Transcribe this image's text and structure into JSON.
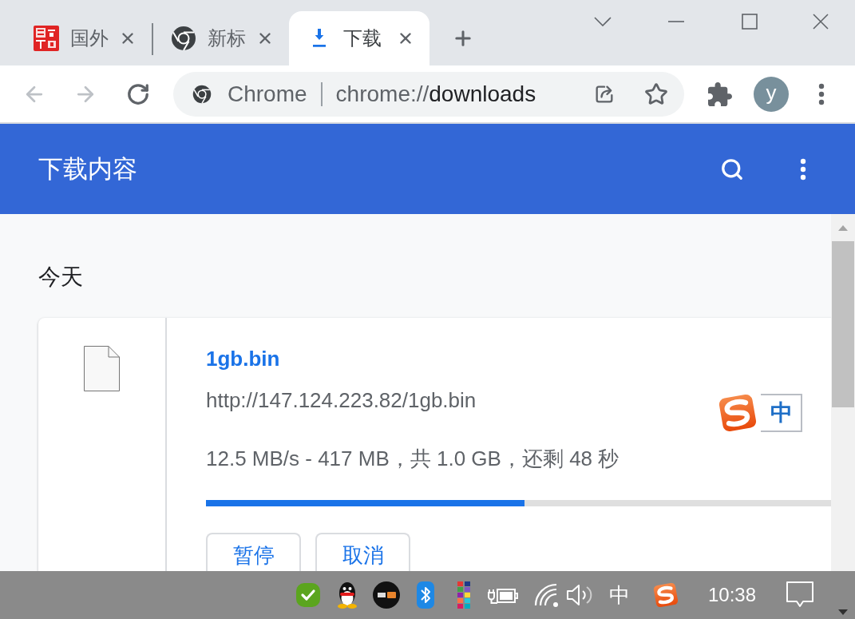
{
  "tabs": [
    {
      "title": "国外",
      "kind": "seal",
      "selected": false
    },
    {
      "title": "新标",
      "kind": "chrome",
      "selected": false
    },
    {
      "title": "下载",
      "kind": "download",
      "selected": true
    }
  ],
  "toolbar": {
    "back": {
      "disabled": true
    },
    "forward": {
      "disabled": true
    },
    "omnibox": {
      "site": "Chrome",
      "url_prefix": "chrome://",
      "url_path": "downloads"
    },
    "avatar": "y"
  },
  "header": {
    "title": "下载内容"
  },
  "downloads": {
    "date_heading": "今天",
    "items": [
      {
        "file_name": "1gb.bin",
        "url": "http://147.124.223.82/1gb.bin",
        "status": "12.5 MB/s - 417 MB，共 1.0 GB，还剩 48 秒",
        "level": 0.51,
        "buttons": [
          "暂停",
          "取消"
        ]
      }
    ]
  },
  "ime_toolbar": {
    "mode": "中"
  },
  "taskbar": {
    "ime": "中",
    "time": "10:38"
  }
}
